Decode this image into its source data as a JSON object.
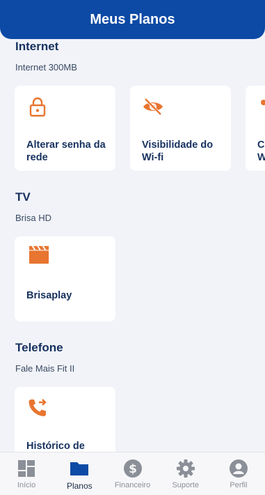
{
  "header": {
    "title": "Meus Planos"
  },
  "sections": {
    "internet": {
      "title": "Internet",
      "plan": "Internet 300MB",
      "cards": [
        {
          "label": "Alterar senha da rede",
          "icon": "lock-icon"
        },
        {
          "label": "Visibilidade do Wi-fi",
          "icon": "eye-off-icon"
        },
        {
          "label": "Co W",
          "icon": "partial-icon"
        }
      ]
    },
    "tv": {
      "title": "TV",
      "plan": "Brisa HD",
      "cards": [
        {
          "label": "Brisaplay",
          "icon": "clapperboard-icon"
        }
      ]
    },
    "phone": {
      "title": "Telefone",
      "plan": "Fale Mais Fit II",
      "cards": [
        {
          "label": "Histórico de",
          "icon": "phone-forward-icon"
        }
      ]
    }
  },
  "nav": {
    "items": [
      {
        "label": "Início",
        "icon": "dashboard-icon",
        "active": false
      },
      {
        "label": "Planos",
        "icon": "folder-icon",
        "active": true
      },
      {
        "label": "Financeiro",
        "icon": "dollar-icon",
        "active": false
      },
      {
        "label": "Suporte",
        "icon": "gear-icon",
        "active": false
      },
      {
        "label": "Perfil",
        "icon": "user-icon",
        "active": false
      }
    ]
  },
  "colors": {
    "brand": "#0d4aa5",
    "accent": "#e87530",
    "text": "#16315e",
    "background": "#f1f3f8"
  }
}
